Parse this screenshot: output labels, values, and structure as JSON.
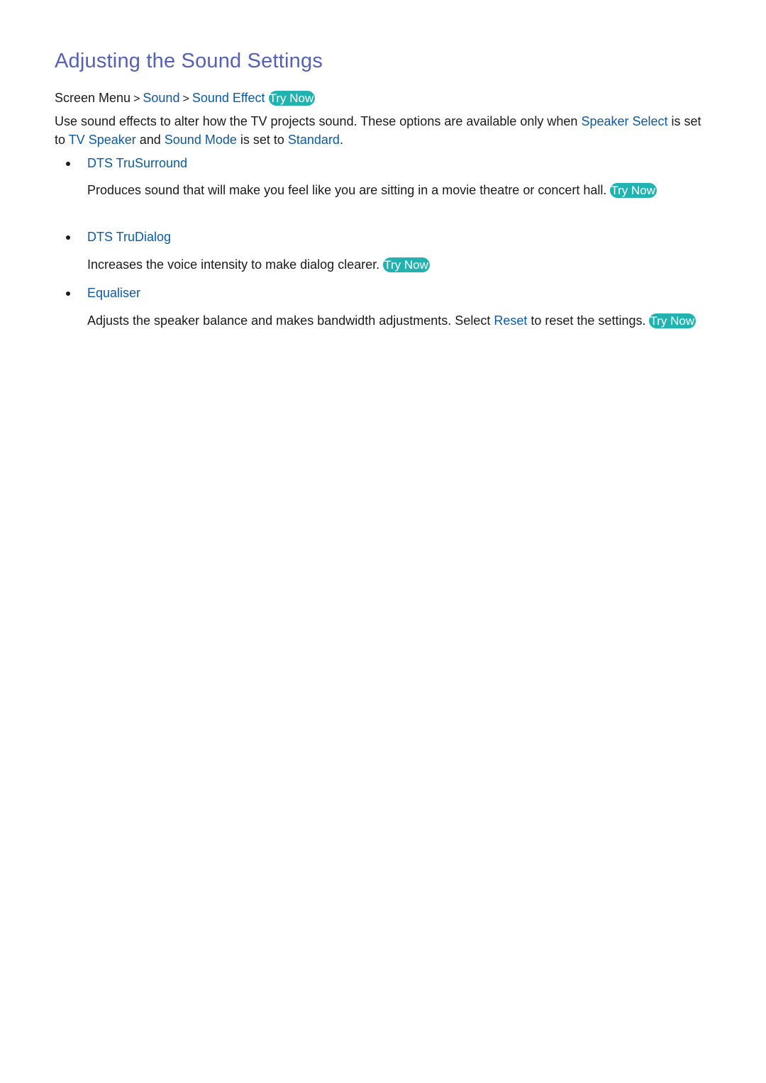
{
  "title": "Adjusting the Sound Settings",
  "breadcrumb": {
    "root": "Screen Menu",
    "items": [
      "Sound",
      "Sound Effect"
    ],
    "separator": ">",
    "try_now": "Try Now"
  },
  "intro": {
    "t1": "Use sound effects to alter how the TV projects sound. These options are available only when ",
    "l1": "Speaker Select",
    "t2": " is set to ",
    "l2": "TV Speaker",
    "t3": " and ",
    "l3": "Sound Mode",
    "t4": " is set to ",
    "l4": "Standard",
    "t5": "."
  },
  "items": [
    {
      "label": "DTS TruSurround",
      "text": "Produces sound that will make you feel like you are sitting in a movie theatre or concert hall.",
      "try_now": "Try Now"
    },
    {
      "label": "DTS TruDialog",
      "text": "Increases the voice intensity to make dialog clearer.",
      "try_now": "Try Now"
    },
    {
      "label": "Equaliser",
      "text_before": "Adjusts the speaker balance and makes bandwidth adjustments. Select ",
      "link": "Reset",
      "text_after": " to reset the settings.",
      "try_now": "Try Now"
    }
  ],
  "colors": {
    "title": "#5560b8",
    "link": "#0b5aa6",
    "try_now_bg": "#21b3b0",
    "body_text": "#1a1a1a"
  }
}
